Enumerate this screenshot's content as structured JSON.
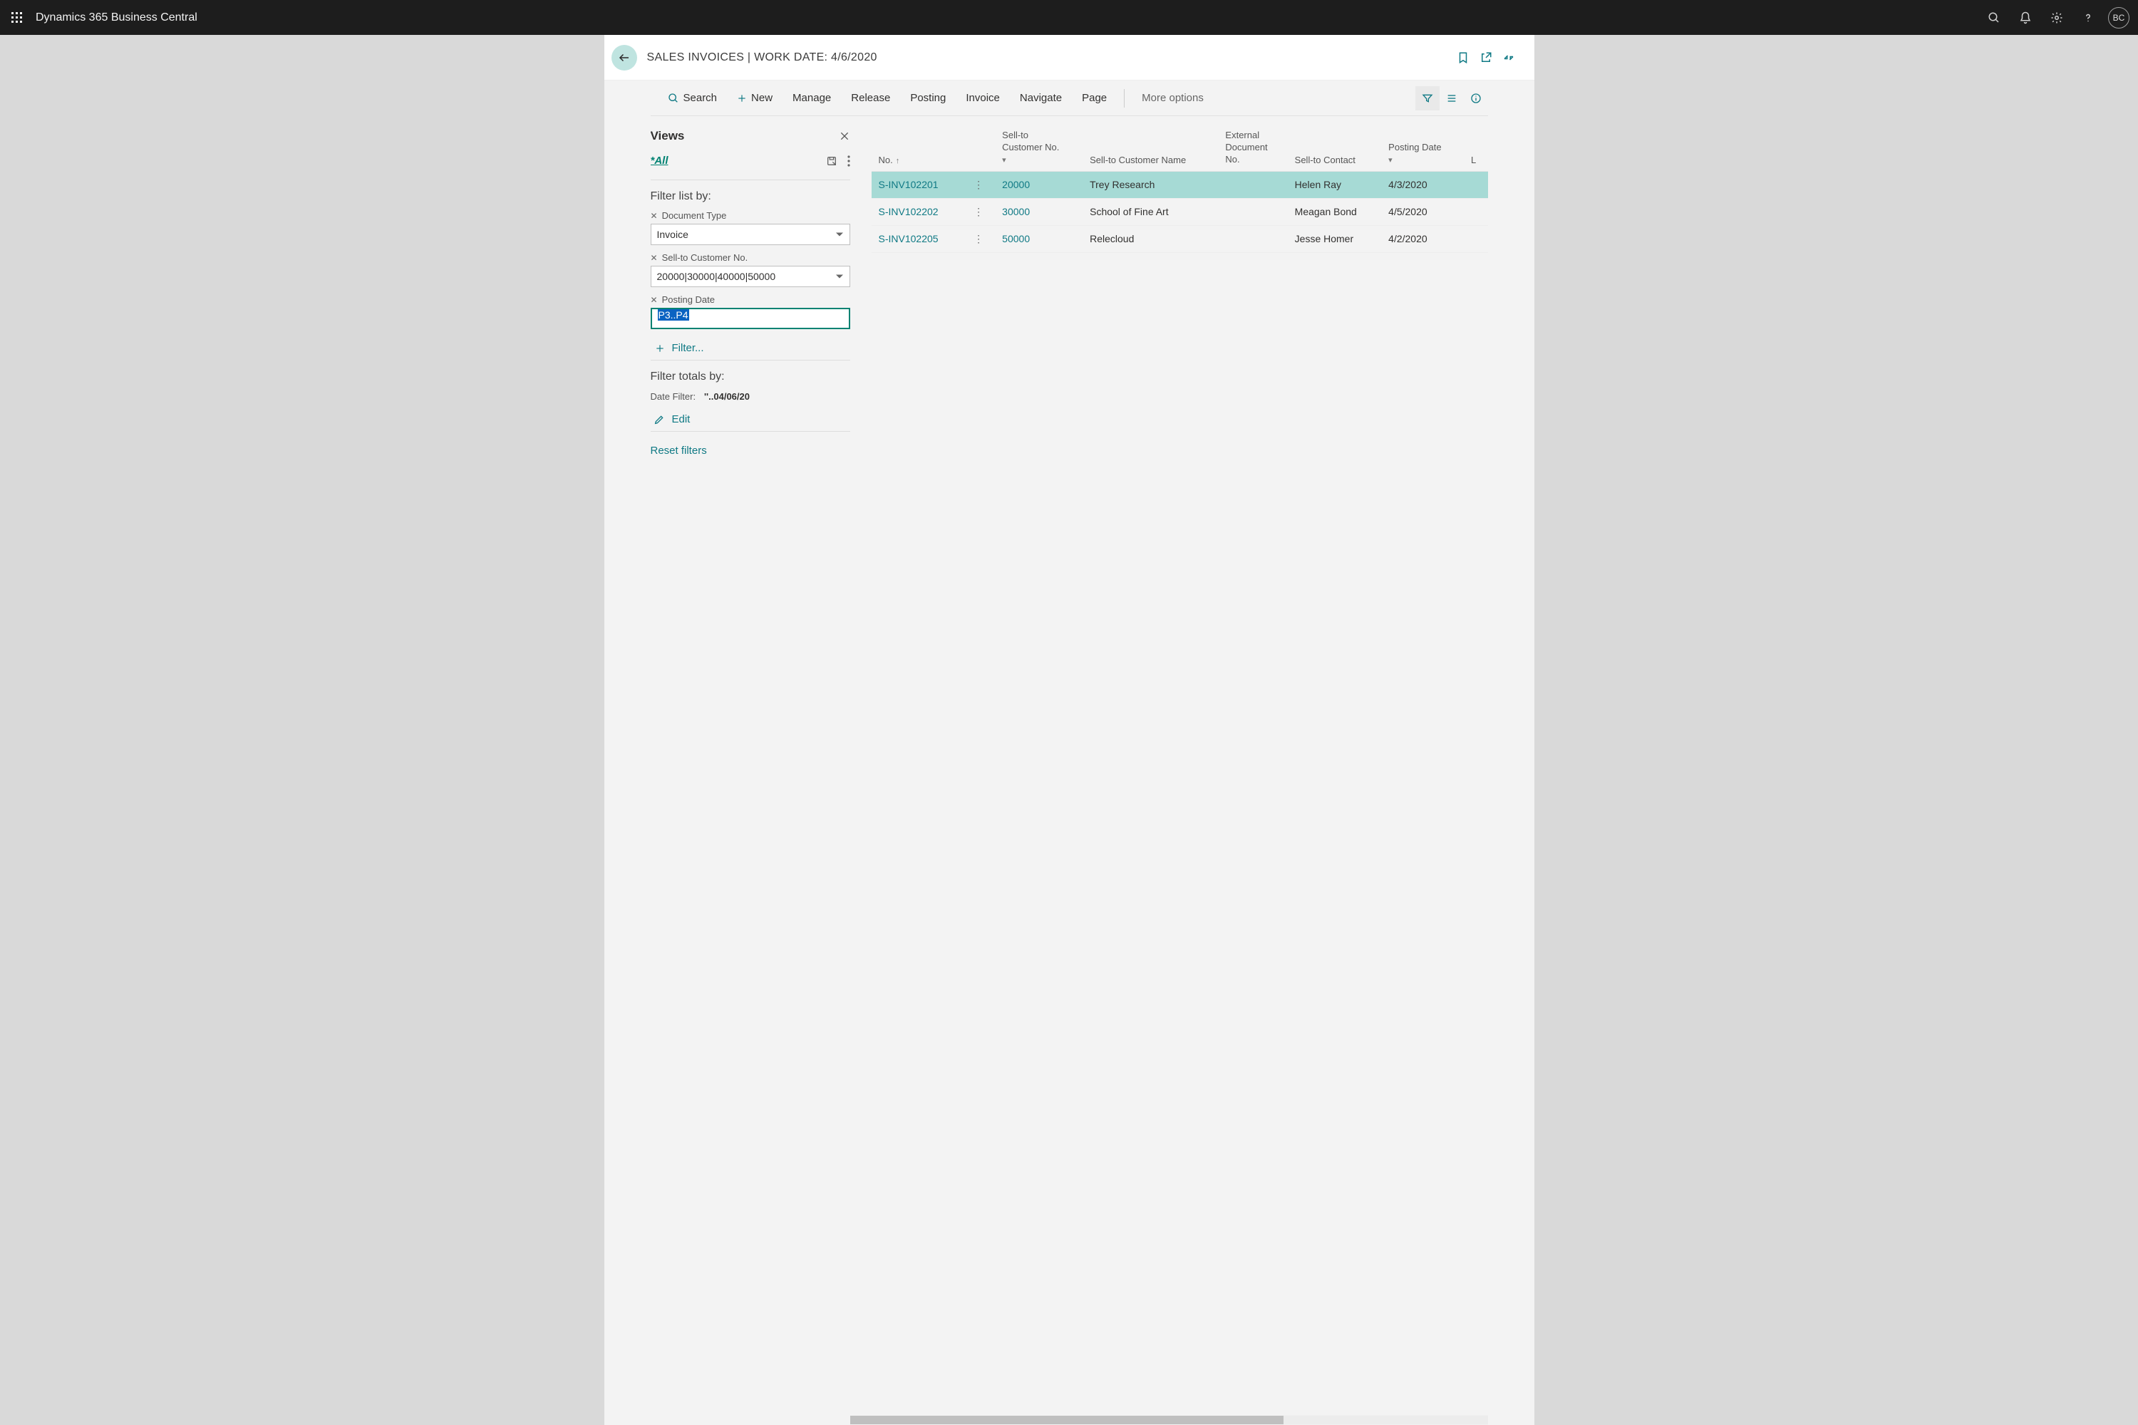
{
  "app_title": "Dynamics 365 Business Central",
  "avatar_initials": "BC",
  "page_title": "SALES INVOICES | WORK DATE: 4/6/2020",
  "actions": {
    "search": "Search",
    "new": "New",
    "manage": "Manage",
    "release": "Release",
    "posting": "Posting",
    "invoice": "Invoice",
    "navigate": "Navigate",
    "page": "Page",
    "more": "More options"
  },
  "views": {
    "title": "Views",
    "all": "*All"
  },
  "filters": {
    "list_title": "Filter list by:",
    "doc_type_label": "Document Type",
    "doc_type_value": "Invoice",
    "cust_no_label": "Sell-to Customer No.",
    "cust_no_value": "20000|30000|40000|50000",
    "posting_date_label": "Posting Date",
    "posting_date_value": "P3..P4",
    "add_filter": "Filter...",
    "totals_title": "Filter totals by:",
    "date_filter_label": "Date Filter:",
    "date_filter_value": "''..04/06/20",
    "edit": "Edit",
    "reset": "Reset filters"
  },
  "columns": {
    "no": "No.",
    "cust_no": "Sell-to Customer No.",
    "cust_name": "Sell-to Customer Name",
    "ext_doc": "External Document No.",
    "contact": "Sell-to Contact",
    "posting_date": "Posting Date",
    "trailing": "L"
  },
  "rows": [
    {
      "no": "S-INV102201",
      "cust_no": "20000",
      "cust_name": "Trey Research",
      "ext_doc": "",
      "contact": "Helen Ray",
      "posting_date": "4/3/2020",
      "selected": true
    },
    {
      "no": "S-INV102202",
      "cust_no": "30000",
      "cust_name": "School of Fine Art",
      "ext_doc": "",
      "contact": "Meagan Bond",
      "posting_date": "4/5/2020",
      "selected": false
    },
    {
      "no": "S-INV102205",
      "cust_no": "50000",
      "cust_name": "Relecloud",
      "ext_doc": "",
      "contact": "Jesse Homer",
      "posting_date": "4/2/2020",
      "selected": false
    }
  ]
}
